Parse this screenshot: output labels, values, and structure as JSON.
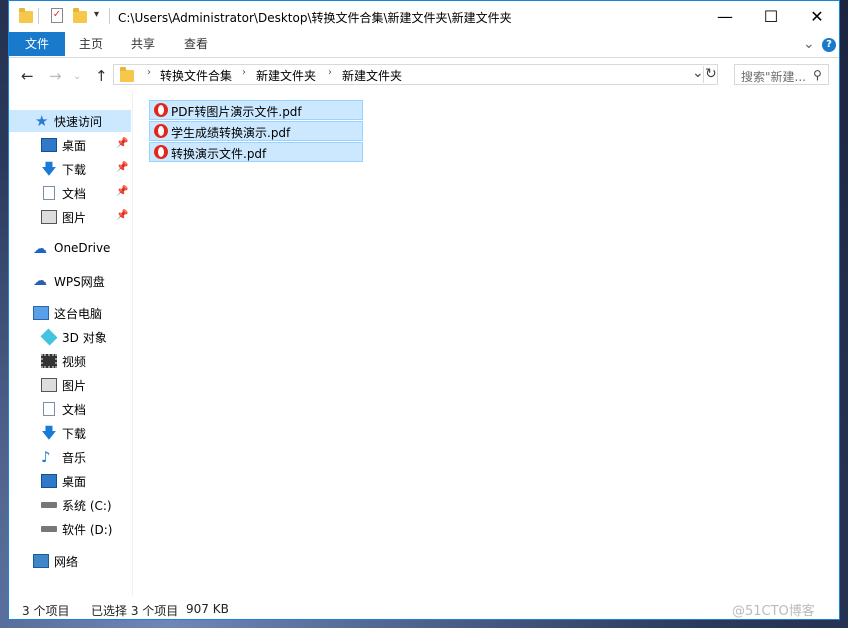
{
  "titlebar": {
    "path": "C:\\Users\\Administrator\\Desktop\\转换文件合集\\新建文件夹\\新建文件夹",
    "minimize_glyph": "—",
    "maximize_glyph": "☐",
    "close_glyph": "✕"
  },
  "ribbon": {
    "tabs": [
      "文件",
      "主页",
      "共享",
      "查看"
    ],
    "expand_glyph": "⌄",
    "help_glyph": "?"
  },
  "address": {
    "back_glyph": "←",
    "forward_glyph": "→",
    "up_glyph": "↑",
    "crumbs": [
      "转换文件合集",
      "新建文件夹",
      "新建文件夹"
    ],
    "crumb_sep": "›",
    "dropdown_glyph": "⌄",
    "refresh_glyph": "↻"
  },
  "search": {
    "placeholder": "搜索\"新建...",
    "icon": "search-icon"
  },
  "navpane": {
    "items": [
      {
        "label": "快速访问",
        "icon": "star-icon",
        "selected": true
      },
      {
        "label": "桌面",
        "icon": "desktop-icon",
        "pinned": true
      },
      {
        "label": "下载",
        "icon": "download-icon",
        "pinned": true
      },
      {
        "label": "文档",
        "icon": "document-icon",
        "pinned": true
      },
      {
        "label": "图片",
        "icon": "picture-icon",
        "pinned": true
      },
      {
        "label": "OneDrive",
        "icon": "onedrive-icon"
      },
      {
        "label": "WPS网盘",
        "icon": "wps-cloud-icon"
      },
      {
        "label": "这台电脑",
        "icon": "this-pc-icon"
      },
      {
        "label": "3D 对象",
        "icon": "3d-objects-icon"
      },
      {
        "label": "视频",
        "icon": "video-icon"
      },
      {
        "label": "图片",
        "icon": "picture-icon"
      },
      {
        "label": "文档",
        "icon": "document-icon"
      },
      {
        "label": "下载",
        "icon": "download-icon"
      },
      {
        "label": "音乐",
        "icon": "music-icon"
      },
      {
        "label": "桌面",
        "icon": "desktop-icon"
      },
      {
        "label": "系统 (C:)",
        "icon": "system-drive-icon"
      },
      {
        "label": "软件 (D:)",
        "icon": "drive-icon"
      },
      {
        "label": "网络",
        "icon": "network-icon"
      }
    ],
    "pin_glyph": "📌"
  },
  "files": [
    {
      "name": "PDF转图片演示文件.pdf",
      "icon": "pdf-icon",
      "selected": true
    },
    {
      "name": "学生成绩转换演示.pdf",
      "icon": "pdf-icon",
      "selected": true
    },
    {
      "name": "转换演示文件.pdf",
      "icon": "pdf-icon",
      "selected": true
    }
  ],
  "status": {
    "count": "3 个项目",
    "selection": "已选择 3 个项目",
    "size": "907 KB"
  },
  "watermark": "@51CTO博客",
  "colors": {
    "accent": "#1979ca",
    "selection": "#cce8ff",
    "selection_border": "#99d1ff",
    "pdf_red": "#e0271b"
  }
}
